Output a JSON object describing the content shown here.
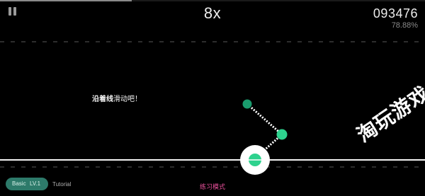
{
  "hud": {
    "combo": "8x",
    "score": "093476",
    "accuracy": "78.88%",
    "song_progress": 0.31
  },
  "hint": {
    "bold": "沿着线",
    "rest": "滑动吧！"
  },
  "footer": {
    "difficulty": "Basic",
    "level": "LV.1",
    "chart_label": "Tutorial",
    "mode": "练习模式"
  },
  "watermark": "淘玩游戏",
  "colors": {
    "note_dark": "#1a9c6e",
    "note_light": "#2ed28e",
    "difficulty_pill": "#2d7a6a",
    "mode_text": "#e8509a"
  },
  "icons": {
    "pause": "pause-icon"
  }
}
